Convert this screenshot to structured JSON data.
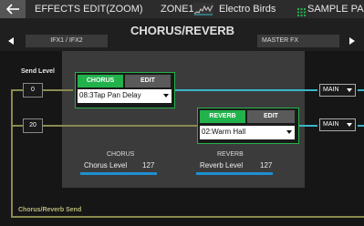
{
  "topbar": {
    "title": "EFFECTS EDIT(ZOOM)",
    "zone": "ZONE1",
    "kit_name": "Electro Birds",
    "sample_pad": "SAMPLE PAD"
  },
  "nav": {
    "sub_left": "IFX1 / IFX2",
    "title": "CHORUS/REVERB",
    "sub_right": "MASTER FX"
  },
  "send_level": {
    "label": "Send Level",
    "chorus_value": "0",
    "reverb_value": "20"
  },
  "chorus": {
    "tab_label": "CHORUS",
    "edit_label": "EDIT",
    "selected": "08:3Tap Pan Delay",
    "section_title": "CHORUS",
    "level_label": "Chorus Level",
    "level_value": "127",
    "level_fraction": 1.0
  },
  "reverb": {
    "tab_label": "REVERB",
    "edit_label": "EDIT",
    "selected": "02:Warm Hall",
    "section_title": "REVERB",
    "level_label": "Reverb Level",
    "level_value": "127",
    "level_fraction": 1.0
  },
  "outputs": {
    "chorus_out": "MAIN",
    "reverb_out": "MAIN"
  },
  "footer_label": "Chorus/Reverb Send",
  "colors": {
    "accent_green": "#22b24c",
    "line_teal": "#39b6c9",
    "line_olive": "#8a8a4e",
    "level_bar": "#1e90d0"
  }
}
